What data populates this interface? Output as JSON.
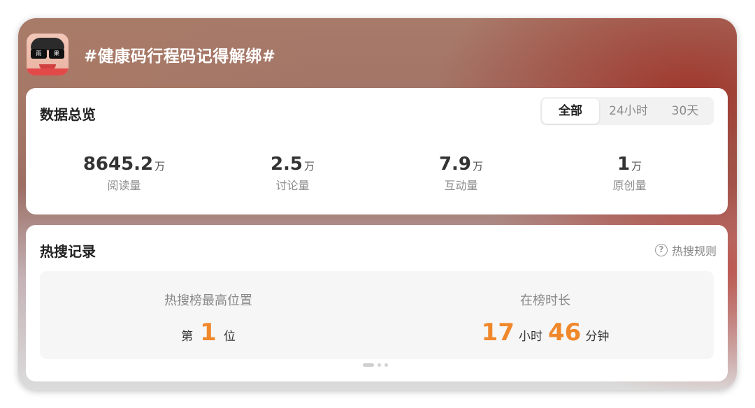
{
  "topic": {
    "title": "#健康码行程码记得解绑#",
    "avatar": {
      "lens_left": "雨",
      "lens_right": "果"
    }
  },
  "overview": {
    "title": "数据总览",
    "segments": [
      {
        "label": "全部",
        "active": true
      },
      {
        "label": "24小时",
        "active": false
      },
      {
        "label": "30天",
        "active": false
      }
    ],
    "stats": [
      {
        "value": "8645.2",
        "unit": "万",
        "label": "阅读量"
      },
      {
        "value": "2.5",
        "unit": "万",
        "label": "讨论量"
      },
      {
        "value": "7.9",
        "unit": "万",
        "label": "互动量"
      },
      {
        "value": "1",
        "unit": "万",
        "label": "原创量"
      }
    ]
  },
  "hot_search": {
    "title": "热搜记录",
    "rules_label": "热搜规则",
    "best_rank": {
      "caption": "热搜榜最高位置",
      "prefix": "第",
      "value": "1",
      "suffix": "位"
    },
    "duration": {
      "caption": "在榜时长",
      "hours": "17",
      "hours_unit": "小时",
      "minutes": "46",
      "minutes_unit": "分钟"
    }
  },
  "colors": {
    "accent": "#f0882b",
    "title_text": "#ffffff"
  }
}
